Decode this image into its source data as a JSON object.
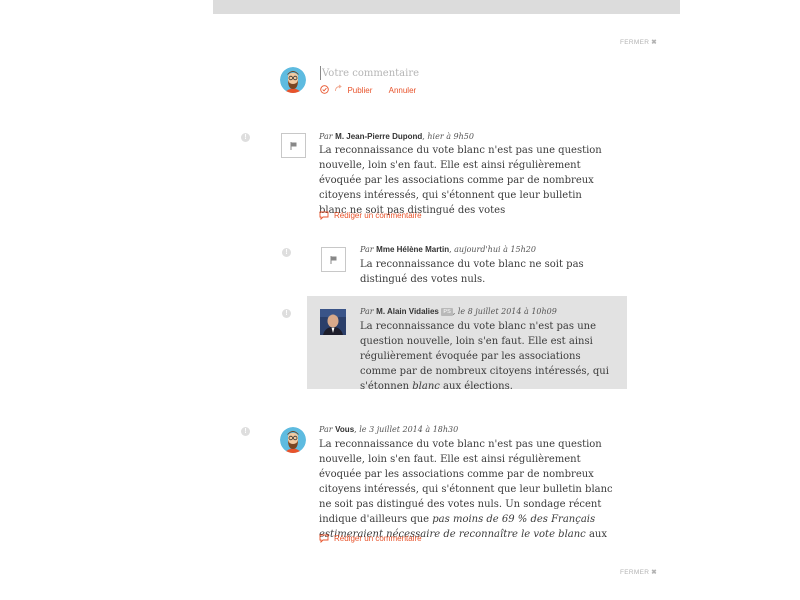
{
  "close_label": "FERMER",
  "composer": {
    "placeholder": "Votre commentaire",
    "publish_label": "Publier",
    "cancel_label": "Annuler"
  },
  "comments": [
    {
      "by": "Par",
      "author": "M. Jean-Pierre Dupond",
      "date": ", hier à 9h50",
      "text": "La reconnaissance du vote blanc n'est pas une question nouvelle, loin s'en faut. Elle est ainsi régulièrement évoquée par les associations comme par de nombreux citoyens intéressés, qui s'étonnent que leur bulletin blanc ne soit pas distingué des votes",
      "reply_label": "Rédiger un commentaire"
    },
    {
      "by": "Par",
      "author": "Mme Hélène Martin",
      "date": ", aujourd'hui à 15h20",
      "text": "La reconnaissance du vote blanc ne soit pas distingué des votes nuls."
    },
    {
      "by": "Par",
      "author": "M. Alain Vidalies",
      "party": "PS",
      "date": ", le 8 juillet 2014 à 10h09",
      "text_before": "La reconnaissance du vote blanc n'est pas une question nouvelle, loin s'en faut. Elle est ainsi régulièrement évoquée par les associations comme par de nombreux citoyens intéressés, qui s'étonnen ",
      "text_italic": "blanc",
      "text_after": " aux élections."
    },
    {
      "by": "Par",
      "author": "Vous",
      "date": ", le 3 juillet 2014 à 18h30",
      "text_before": "La reconnaissance du vote blanc n'est pas une question nouvelle, loin s'en faut. Elle est ainsi régulièrement évoquée par les associations comme par de nombreux citoyens intéressés, qui s'étonnent que leur bulletin blanc ne soit pas distingué des votes nuls. Un sondage récent indique d'ailleurs que ",
      "text_italic": "pas moins de 69 % des Français estimeraient nécessaire de reconnaître le vote blanc",
      "text_after": " aux",
      "reply_label": "Rédiger un commentaire"
    }
  ],
  "colors": {
    "accent": "#e8532b",
    "highlight_bg": "#e2e2e2",
    "topbar": "#dcdcdc"
  },
  "icons": [
    "bearded-avatar",
    "flag-icon",
    "politician-photo",
    "check-circle-icon",
    "refresh-arrow-icon",
    "comment-bubble-icon",
    "close-x-icon",
    "info-bubble-icon"
  ]
}
